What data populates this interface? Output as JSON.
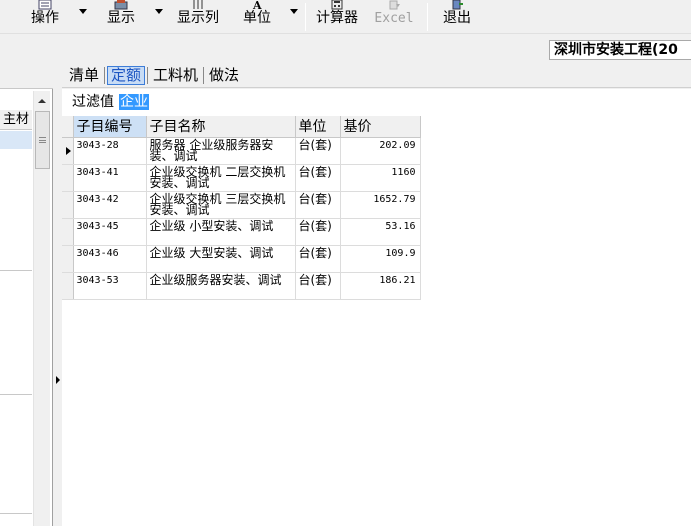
{
  "toolbar": {
    "operate_label": "操作",
    "display_label": "显示",
    "columns_label": "显示列",
    "unit_label": "单位",
    "calculator_label": "计算器",
    "excel_label": "Excel",
    "exit_label": "退出"
  },
  "title": "深圳市安装工程(20",
  "left_panel": {
    "column_header": "主材"
  },
  "tabs": [
    {
      "label": "清单",
      "active": false
    },
    {
      "label": "定额",
      "active": true
    },
    {
      "label": "工料机",
      "active": false
    },
    {
      "label": "做法",
      "active": false
    }
  ],
  "filter": {
    "label": "过滤值",
    "value": "企业"
  },
  "grid": {
    "columns": [
      "子目编号",
      "子目名称",
      "单位",
      "基价"
    ],
    "rows": [
      {
        "code": "3043-28",
        "name": "服务器 企业级服务器安装、调试",
        "unit": "台(套)",
        "price": "202.09"
      },
      {
        "code": "3043-41",
        "name": "企业级交换机 二层交换机安装、调试",
        "unit": "台(套)",
        "price": "1160"
      },
      {
        "code": "3043-42",
        "name": "企业级交换机 三层交换机安装、调试",
        "unit": "台(套)",
        "price": "1652.79"
      },
      {
        "code": "3043-45",
        "name": "企业级 小型安装、调试",
        "unit": "台(套)",
        "price": "53.16"
      },
      {
        "code": "3043-46",
        "name": "企业级 大型安装、调试",
        "unit": "台(套)",
        "price": "109.9"
      },
      {
        "code": "3043-53",
        "name": "企业级服务器安装、调试",
        "unit": "台(套)",
        "price": "186.21"
      }
    ]
  },
  "colors": {
    "accent": "#3d7dd8",
    "selection": "#3399ff",
    "header_bg": "#f0f0f0"
  }
}
